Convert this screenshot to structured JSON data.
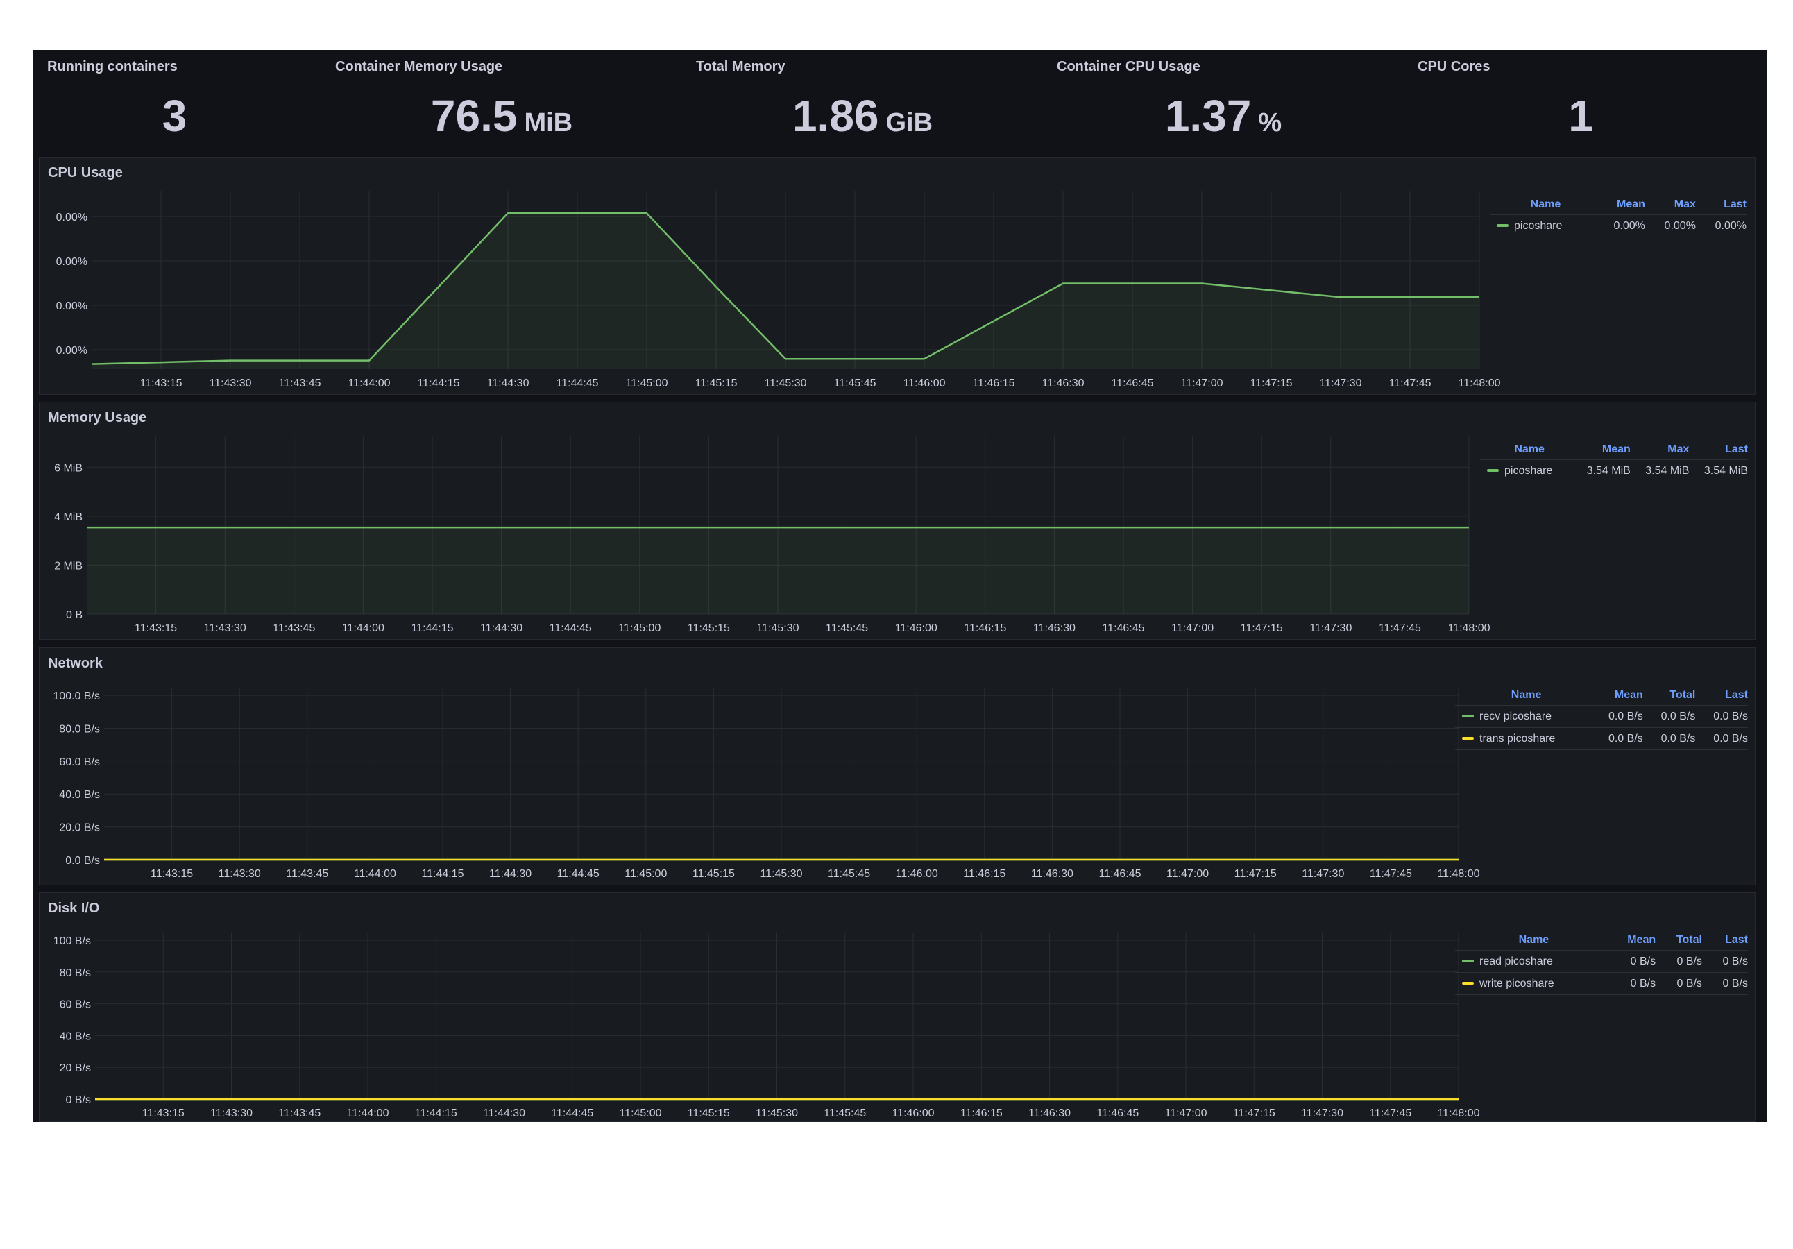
{
  "stats": [
    {
      "title": "Running containers",
      "value": "3",
      "unit": ""
    },
    {
      "title": "Container Memory Usage",
      "value": "76.5",
      "unit": "MiB"
    },
    {
      "title": "Total Memory",
      "value": "1.86",
      "unit": "GiB"
    },
    {
      "title": "Container CPU Usage",
      "value": "1.37",
      "unit": "%"
    },
    {
      "title": "CPU Cores",
      "value": "1",
      "unit": ""
    }
  ],
  "colors": {
    "green": "#73bf69",
    "yellow": "#fade2a",
    "legend_header": "#6e9fff",
    "text": "#ccccdc"
  },
  "panels": {
    "cpu": {
      "title": "CPU Usage",
      "legend": {
        "headers": [
          "Name",
          "Mean",
          "Max",
          "Last"
        ],
        "rows": [
          {
            "name": "picoshare",
            "color": "#73bf69",
            "values": [
              "0.00%",
              "0.00%",
              "0.00%"
            ]
          }
        ]
      }
    },
    "memory": {
      "title": "Memory Usage",
      "legend": {
        "headers": [
          "Name",
          "Mean",
          "Max",
          "Last"
        ],
        "rows": [
          {
            "name": "picoshare",
            "color": "#73bf69",
            "values": [
              "3.54 MiB",
              "3.54 MiB",
              "3.54 MiB"
            ]
          }
        ]
      }
    },
    "network": {
      "title": "Network",
      "legend": {
        "headers": [
          "Name",
          "Mean",
          "Total",
          "Last"
        ],
        "rows": [
          {
            "name": "recv picoshare",
            "color": "#73bf69",
            "values": [
              "0.0 B/s",
              "0.0 B/s",
              "0.0 B/s"
            ]
          },
          {
            "name": "trans picoshare",
            "color": "#fade2a",
            "values": [
              "0.0 B/s",
              "0.0 B/s",
              "0.0 B/s"
            ]
          }
        ]
      }
    },
    "disk": {
      "title": "Disk I/O",
      "legend": {
        "headers": [
          "Name",
          "Mean",
          "Total",
          "Last"
        ],
        "rows": [
          {
            "name": "read picoshare",
            "color": "#73bf69",
            "values": [
              "0 B/s",
              "0 B/s",
              "0 B/s"
            ]
          },
          {
            "name": "write picoshare",
            "color": "#fade2a",
            "values": [
              "0 B/s",
              "0 B/s",
              "0 B/s"
            ]
          }
        ]
      }
    }
  },
  "chart_data": [
    {
      "type": "area",
      "title": "CPU Usage",
      "x": [
        "11:43:00",
        "11:43:15",
        "11:43:30",
        "11:43:45",
        "11:44:00",
        "11:44:15",
        "11:44:30",
        "11:44:45",
        "11:45:00",
        "11:45:15",
        "11:45:30",
        "11:45:45",
        "11:46:00",
        "11:46:15",
        "11:46:30",
        "11:46:45",
        "11:47:00",
        "11:47:15",
        "11:47:30",
        "11:47:45",
        "11:48:00"
      ],
      "x_ticks": [
        "11:43:15",
        "11:43:30",
        "11:43:45",
        "11:44:00",
        "11:44:15",
        "11:44:30",
        "11:44:45",
        "11:45:00",
        "11:45:15",
        "11:45:30",
        "11:45:45",
        "11:46:00",
        "11:46:15",
        "11:46:30",
        "11:46:45",
        "11:47:00",
        "11:47:15",
        "11:47:30",
        "11:47:45",
        "11:48:00"
      ],
      "y_ticks": [
        "0.00%",
        "0.00%",
        "0.00%",
        "0.00%"
      ],
      "series": [
        {
          "name": "picoshare",
          "values": [
            3e-05,
            4e-05,
            5e-05,
            5e-05,
            5e-05,
            0.00048,
            0.00091,
            0.00091,
            0.00091,
            0.00048,
            6e-05,
            6e-05,
            6e-05,
            0.00028,
            0.0005,
            0.0005,
            0.0005,
            0.00046,
            0.00042,
            0.00042,
            0.00042
          ]
        }
      ],
      "ylim": [
        0,
        0.001
      ],
      "grid": true,
      "legend_position": "right"
    },
    {
      "type": "area",
      "title": "Memory Usage",
      "x_ticks": [
        "11:43:15",
        "11:43:30",
        "11:43:45",
        "11:44:00",
        "11:44:15",
        "11:44:30",
        "11:44:45",
        "11:45:00",
        "11:45:15",
        "11:45:30",
        "11:45:45",
        "11:46:00",
        "11:46:15",
        "11:46:30",
        "11:46:45",
        "11:47:00",
        "11:47:15",
        "11:47:30",
        "11:47:45",
        "11:48:00"
      ],
      "y_ticks": [
        "0 B",
        "2 MiB",
        "4 MiB",
        "6 MiB"
      ],
      "series": [
        {
          "name": "picoshare",
          "values": [
            3.54,
            3.54
          ]
        }
      ],
      "x": [
        "11:43:00",
        "11:48:00"
      ],
      "ylim": [
        0,
        7
      ],
      "y_unit": "MiB",
      "grid": true,
      "legend_position": "right"
    },
    {
      "type": "line",
      "title": "Network",
      "x_ticks": [
        "11:43:15",
        "11:43:30",
        "11:43:45",
        "11:44:00",
        "11:44:15",
        "11:44:30",
        "11:44:45",
        "11:45:00",
        "11:45:15",
        "11:45:30",
        "11:45:45",
        "11:46:00",
        "11:46:15",
        "11:46:30",
        "11:46:45",
        "11:47:00",
        "11:47:15",
        "11:47:30",
        "11:47:45",
        "11:48:00"
      ],
      "y_ticks": [
        "0.0 B/s",
        "20.0 B/s",
        "40.0 B/s",
        "60.0 B/s",
        "80.0 B/s",
        "100.0 B/s"
      ],
      "x": [
        "11:43:00",
        "11:48:00"
      ],
      "series": [
        {
          "name": "recv picoshare",
          "values": [
            0,
            0
          ]
        },
        {
          "name": "trans picoshare",
          "values": [
            0,
            0
          ]
        }
      ],
      "ylim": [
        0,
        100
      ],
      "grid": true,
      "legend_position": "right"
    },
    {
      "type": "line",
      "title": "Disk I/O",
      "x_ticks": [
        "11:43:15",
        "11:43:30",
        "11:43:45",
        "11:44:00",
        "11:44:15",
        "11:44:30",
        "11:44:45",
        "11:45:00",
        "11:45:15",
        "11:45:30",
        "11:45:45",
        "11:46:00",
        "11:46:15",
        "11:46:30",
        "11:46:45",
        "11:47:00",
        "11:47:15",
        "11:47:30",
        "11:47:45",
        "11:48:00"
      ],
      "y_ticks": [
        "0 B/s",
        "20 B/s",
        "40 B/s",
        "60 B/s",
        "80 B/s",
        "100 B/s"
      ],
      "x": [
        "11:43:00",
        "11:48:00"
      ],
      "series": [
        {
          "name": "read picoshare",
          "values": [
            0,
            0
          ]
        },
        {
          "name": "write picoshare",
          "values": [
            0,
            0
          ]
        }
      ],
      "ylim": [
        0,
        100
      ],
      "grid": true,
      "legend_position": "right"
    }
  ]
}
